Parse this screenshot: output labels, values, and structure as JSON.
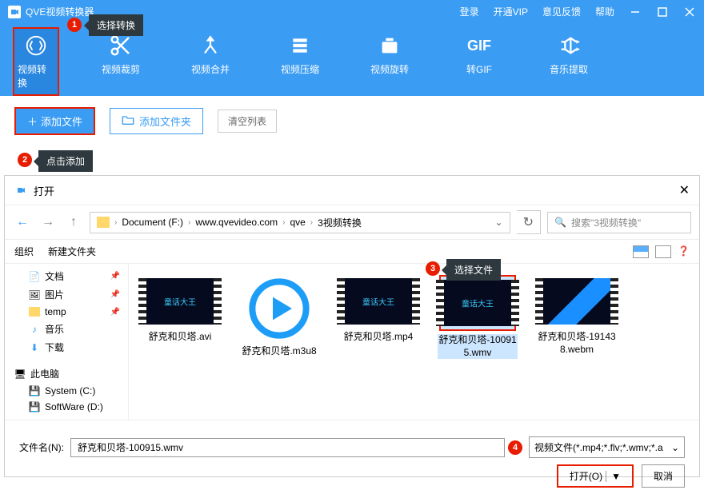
{
  "app": {
    "title": "QVE视频转换器"
  },
  "topLinks": {
    "login": "登录",
    "vip": "开通VIP",
    "feedback": "意见反馈",
    "help": "帮助"
  },
  "tabs": {
    "convert": "视频转换",
    "crop": "视频裁剪",
    "merge": "视频合并",
    "compress": "视频压缩",
    "rotate": "视频旋转",
    "gif": "转GIF",
    "audio": "音乐提取"
  },
  "tooltips": {
    "selectConvert": "选择转换",
    "clickAdd": "点击添加",
    "selectFile": "选择文件"
  },
  "badges": {
    "b1": "1",
    "b2": "2",
    "b3": "3",
    "b4": "4"
  },
  "actions": {
    "addFile": "添加文件",
    "addFolder": "添加文件夹",
    "clear": "清空列表"
  },
  "dialog": {
    "title": "打开",
    "breadcrumb": {
      "drive": "Document (F:)",
      "p1": "www.qvevideo.com",
      "p2": "qve",
      "p3": "3视频转换"
    },
    "searchPlaceholder": "搜索\"3视频转换\"",
    "toolbar": {
      "organize": "组织",
      "newFolder": "新建文件夹"
    },
    "sidebar": {
      "docs": "文档",
      "pics": "图片",
      "temp": "temp",
      "music": "音乐",
      "downloads": "下载",
      "thispc": "此电脑",
      "sysC": "System (C:)",
      "softD": "SoftWare (D:)"
    },
    "files": {
      "f1": "舒克和贝塔.avi",
      "f2": "舒克和贝塔.m3u8",
      "f3": "舒克和贝塔.mp4",
      "f4": "舒克和贝塔-100915.wmv",
      "f5": "舒克和贝塔-191438.webm",
      "thumbText": "童话大王"
    },
    "footer": {
      "fileLabel": "文件名(N):",
      "fileName": "舒克和贝塔-100915.wmv",
      "typeFilter": "视频文件(*.mp4;*.flv;*.wmv;*.a",
      "open": "打开(O)",
      "cancel": "取消"
    }
  }
}
